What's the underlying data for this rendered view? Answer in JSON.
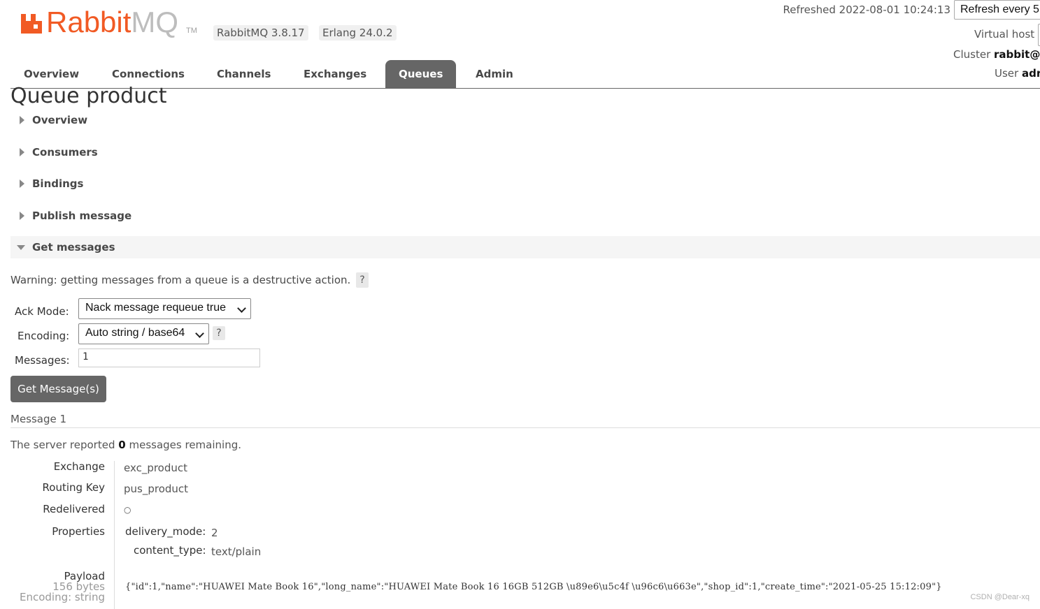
{
  "header": {
    "logo_word": "Rabbit",
    "logo_mq": "MQ",
    "logo_tm": "TM",
    "rabbitmq_version": "RabbitMQ 3.8.17",
    "erlang_version": "Erlang 24.0.2",
    "refreshed_label": "Refreshed 2022-08-01 10:24:13",
    "refresh_select_value": "Refresh every 5",
    "virtual_host_label": "Virtual host",
    "cluster_label": "Cluster",
    "cluster_value": "rabbit@",
    "user_label": "User",
    "user_value": "adr"
  },
  "nav": {
    "tabs": [
      {
        "label": "Overview"
      },
      {
        "label": "Connections"
      },
      {
        "label": "Channels"
      },
      {
        "label": "Exchanges"
      },
      {
        "label": "Queues",
        "active": true
      },
      {
        "label": "Admin"
      }
    ]
  },
  "page": {
    "title": "Queue product",
    "sections": [
      {
        "label": "Overview",
        "expanded": false
      },
      {
        "label": "Consumers",
        "expanded": false
      },
      {
        "label": "Bindings",
        "expanded": false
      },
      {
        "label": "Publish message",
        "expanded": false
      },
      {
        "label": "Get messages",
        "expanded": true
      }
    ]
  },
  "get_messages": {
    "warning": "Warning: getting messages from a queue is a destructive action.",
    "help_glyph": "?",
    "ack_mode_label": "Ack Mode:",
    "ack_mode_value": "Nack message requeue true",
    "encoding_label": "Encoding:",
    "encoding_value": "Auto string / base64",
    "messages_label": "Messages:",
    "messages_value": "1",
    "button_label": "Get Message(s)"
  },
  "result": {
    "message_heading": "Message 1",
    "remaining_prefix": "The server reported",
    "remaining_count": "0",
    "remaining_suffix": "messages remaining.",
    "exchange_label": "Exchange",
    "exchange_value": "exc_product",
    "routing_key_label": "Routing Key",
    "routing_key_value": "pus_product",
    "redelivered_label": "Redelivered",
    "redelivered_value": "○",
    "properties_label": "Properties",
    "delivery_mode_label": "delivery_mode:",
    "delivery_mode_value": "2",
    "content_type_label": "content_type:",
    "content_type_value": "text/plain",
    "payload_label": "Payload",
    "payload_size": "156 bytes",
    "payload_encoding": "Encoding: string",
    "payload_value": "{\"id\":1,\"name\":\"HUAWEI Mate Book 16\",\"long_name\":\"HUAWEI Mate Book 16 16GB 512GB \\u89e6\\u5c4f \\u96c6\\u663e\",\"shop_id\":1,\"create_time\":\"2021-05-25 15:12:09\"}"
  },
  "watermark": "CSDN @Dear-xq",
  "colors": {
    "brand_orange": "#f15a24",
    "tab_active_bg": "#666666",
    "button_bg": "#666666"
  }
}
